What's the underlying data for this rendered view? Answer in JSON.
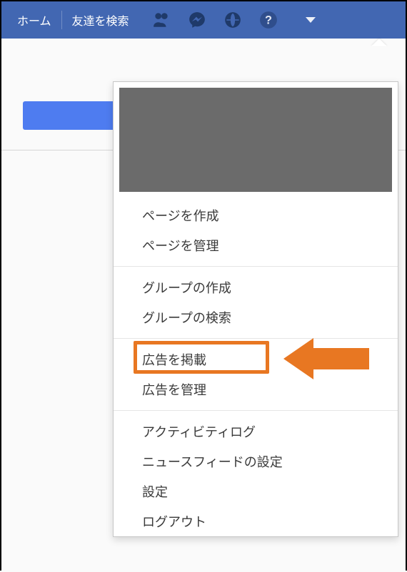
{
  "nav": {
    "home": "ホーム",
    "find_friends": "友達を検索"
  },
  "dropdown": {
    "section1": [
      {
        "label": "ページを作成"
      },
      {
        "label": "ページを管理"
      }
    ],
    "section2": [
      {
        "label": "グループの作成"
      },
      {
        "label": "グループの検索"
      }
    ],
    "section3": [
      {
        "label": "広告を掲載"
      },
      {
        "label": "広告を管理"
      }
    ],
    "section4": [
      {
        "label": "アクティビティログ"
      },
      {
        "label": "ニュースフィードの設定"
      },
      {
        "label": "設定"
      },
      {
        "label": "ログアウト"
      }
    ]
  },
  "colors": {
    "header": "#4267b2",
    "annotation": "#e87722"
  }
}
